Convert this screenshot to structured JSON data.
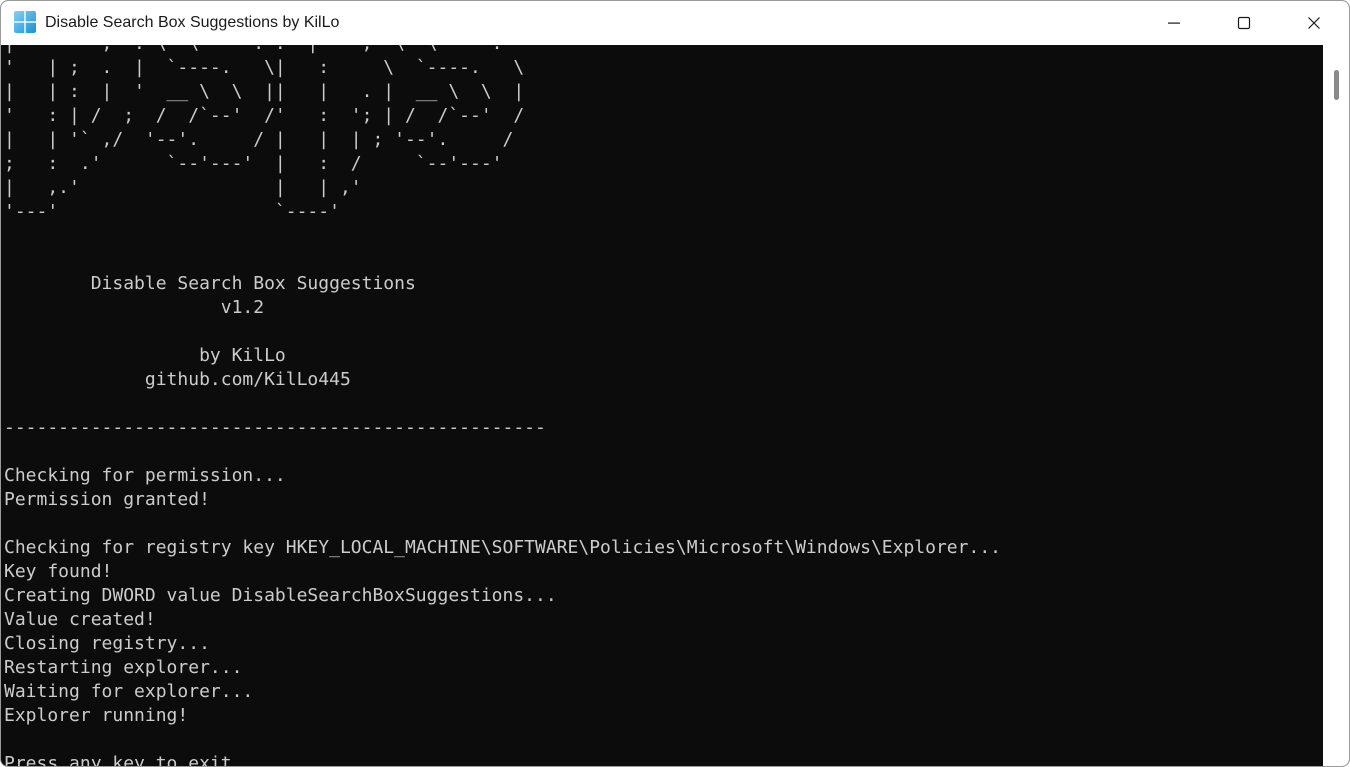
{
  "window": {
    "title": "Disable Search Box Suggestions by KilLo",
    "icon": "terminal-app-icon",
    "controls": {
      "minimize": "minimize-icon",
      "maximize": "maximize-icon",
      "close": "close-icon"
    }
  },
  "console": {
    "lines": [
      "|   ' '  ;  : \\  \\    `. :  |    ;  \\  \\    `.",
      "'   | ;  .  |  `----.   \\|   :     \\  `----.   \\",
      "|   | :  |  '  __ \\  \\  ||   |   . |  __ \\  \\  |",
      "'   : | /  ;  /  /`--'  /'   :  '; | /  /`--'  /",
      "|   | '` ,/  '--'.     / |   |  | ; '--'.     /",
      ";   :  .'      `--'---'  |   :  /     `--'---'",
      "|   ,.'                  |   | ,'",
      "'---'                    `----'",
      "",
      "",
      "        Disable Search Box Suggestions",
      "                    v1.2",
      "",
      "                  by KilLo",
      "             github.com/KilLo445",
      "",
      "--------------------------------------------------",
      "",
      "Checking for permission...",
      "Permission granted!",
      "",
      "Checking for registry key HKEY_LOCAL_MACHINE\\SOFTWARE\\Policies\\Microsoft\\Windows\\Explorer...",
      "Key found!",
      "Creating DWORD value DisableSearchBoxSuggestions...",
      "Value created!",
      "Closing registry...",
      "Restarting explorer...",
      "Waiting for explorer...",
      "Explorer running!",
      "",
      "Press any key to exit..."
    ]
  },
  "colors": {
    "console_bg": "#0c0c0c",
    "console_fg": "#cccccc",
    "titlebar_bg": "#ffffff",
    "icon_accent": "#2aa6e8"
  }
}
